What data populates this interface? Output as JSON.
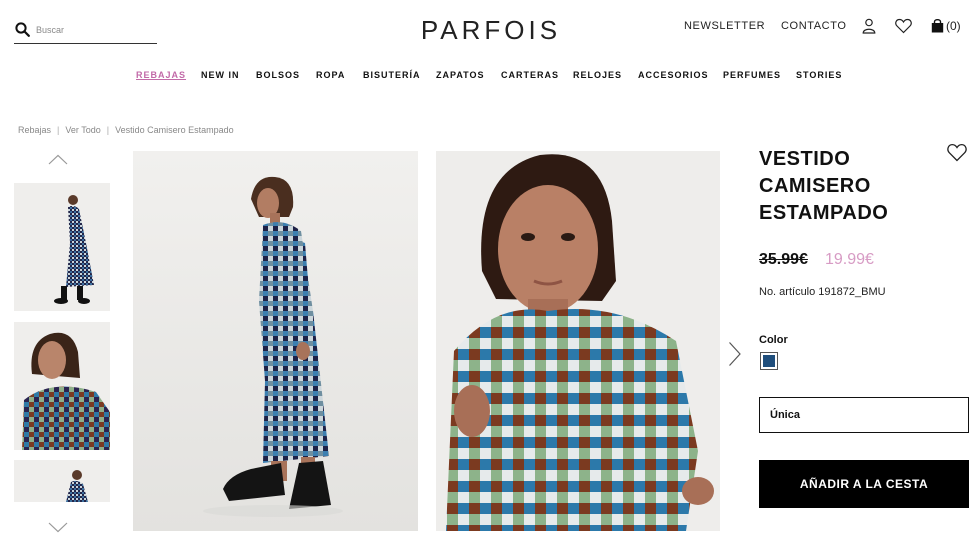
{
  "header": {
    "search_placeholder": "Buscar",
    "logo": "PARFOIS",
    "newsletter": "NEWSLETTER",
    "contacto": "CONTACTO",
    "cart_count": "(0)"
  },
  "nav": [
    {
      "label": "REBAJAS",
      "active": true
    },
    {
      "label": "NEW IN"
    },
    {
      "label": "BOLSOS"
    },
    {
      "label": "ROPA"
    },
    {
      "label": "BISUTERÍA"
    },
    {
      "label": "ZAPATOS"
    },
    {
      "label": "CARTERAS"
    },
    {
      "label": "RELOJES"
    },
    {
      "label": "ACCESORIOS"
    },
    {
      "label": "PERFUMES"
    },
    {
      "label": "STORIES"
    }
  ],
  "breadcrumb": [
    "Rebajas",
    "Ver Todo",
    "Vestido Camisero Estampado"
  ],
  "product": {
    "title": "VESTIDO CAMISERO ESTAMPADO",
    "old_price": "35.99€",
    "new_price": "19.99€",
    "ref": "No. artículo 191872_BMU",
    "color_label": "Color",
    "color_swatch": "#1f4e7c",
    "size": "Única",
    "add_to_cart": "AÑADIR A LA CESTA"
  },
  "colors": {
    "accent_pink": "#c26aa8",
    "sale_price": "#d79bc4",
    "button_bg": "#000000"
  }
}
